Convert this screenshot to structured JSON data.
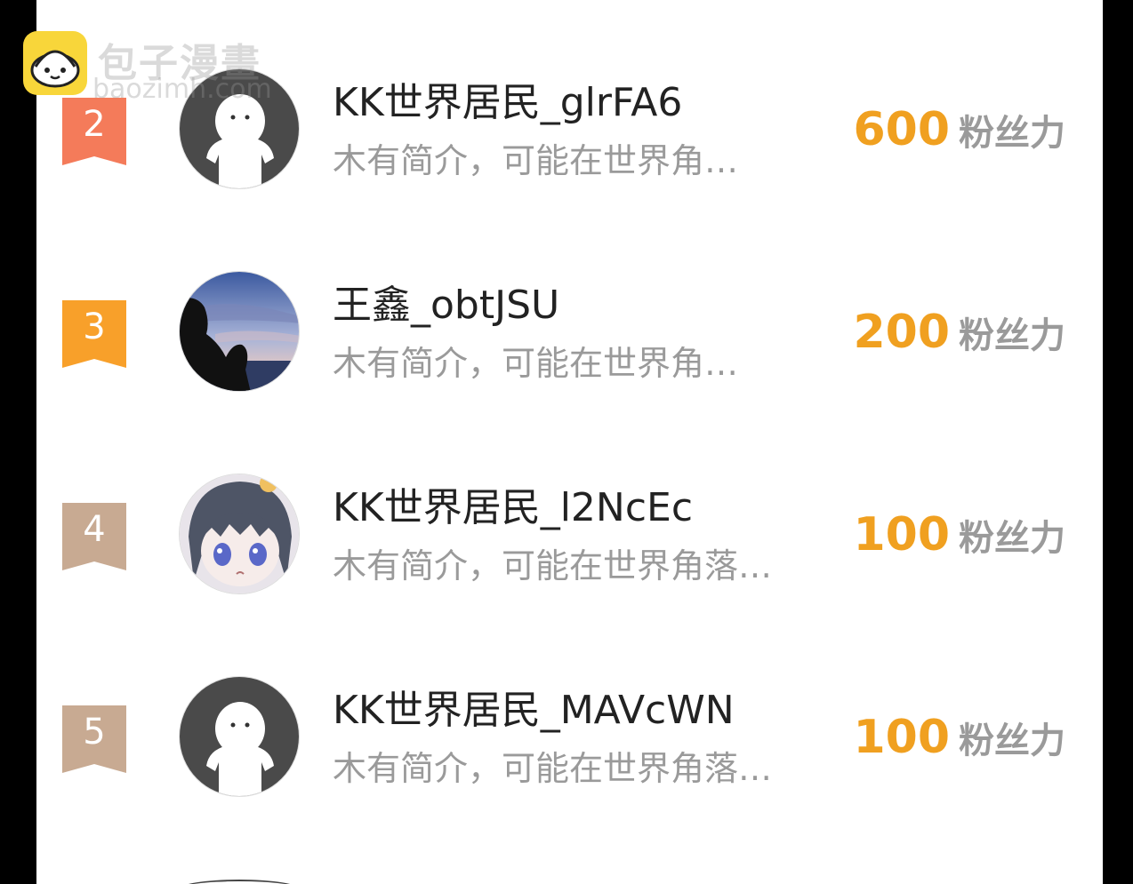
{
  "watermark": {
    "site_name": "包子漫畫",
    "site_url": "baozimh.com"
  },
  "colors": {
    "rank_2": "#f47b5a",
    "rank_3": "#f8a02a",
    "rank_other": "#c8aa92",
    "score": "#f0a020"
  },
  "rows": [
    {
      "rank": "2",
      "name": "KK世界居民_glrFA6",
      "bio": "木有简介，可能在世界角…",
      "score": "600",
      "unit": "粉丝力",
      "avatar_icon": "default-user-icon"
    },
    {
      "rank": "3",
      "name": "王鑫_obtJSU",
      "bio": "木有简介，可能在世界角…",
      "score": "200",
      "unit": "粉丝力",
      "avatar_icon": "photo-avatar"
    },
    {
      "rank": "4",
      "name": "KK世界居民_l2NcEc",
      "bio": "木有简介，可能在世界角落…",
      "score": "100",
      "unit": "粉丝力",
      "avatar_icon": "anime-avatar"
    },
    {
      "rank": "5",
      "name": "KK世界居民_MAVcWN",
      "bio": "木有简介，可能在世界角落…",
      "score": "100",
      "unit": "粉丝力",
      "avatar_icon": "default-user-icon"
    }
  ]
}
